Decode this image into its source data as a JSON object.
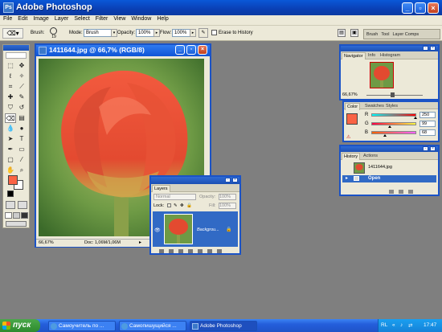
{
  "app": {
    "title": "Adobe Photoshop"
  },
  "menu": [
    "File",
    "Edit",
    "Image",
    "Layer",
    "Select",
    "Filter",
    "View",
    "Window",
    "Help"
  ],
  "options": {
    "brush_label": "Brush:",
    "brush_size": "19",
    "mode_label": "Mode:",
    "mode_value": "Brush",
    "opacity_label": "Opacity:",
    "opacity_value": "100%",
    "flow_label": "Flow:",
    "flow_value": "100%",
    "erase_history_label": "Erase to History",
    "palette_well_tabs": [
      "Brush",
      "Tool",
      "Layer Comps"
    ]
  },
  "document": {
    "title": "1411644.jpg @ 66,7% (RGB/8)",
    "zoom": "66,67%",
    "doc_info": "Doc: 1,06M/1,06M"
  },
  "navigator": {
    "tabs": [
      "Navigator",
      "Info",
      "Histogram"
    ],
    "zoom": "66,67%"
  },
  "color": {
    "tabs": [
      "Color",
      "Swatches",
      "Styles"
    ],
    "channels": [
      {
        "label": "R",
        "value": "250",
        "slider": 0.98
      },
      {
        "label": "G",
        "value": "99",
        "slider": 0.39
      },
      {
        "label": "B",
        "value": "68",
        "slider": 0.27
      }
    ],
    "foreground": "#fa6344"
  },
  "history": {
    "tabs": [
      "History",
      "Actions"
    ],
    "snapshot_name": "1411644.jpg",
    "states": [
      "Open"
    ]
  },
  "layers": {
    "tab": "Layers",
    "blend_mode": "Normal",
    "opacity_label": "Opacity:",
    "opacity_value": "100%",
    "lock_label": "Lock:",
    "fill_label": "Fill:",
    "fill_value": "100%",
    "layer_name": "Backgrou..."
  },
  "taskbar": {
    "start": "пуск",
    "buttons": [
      "Самоучитель по ...",
      "Самопишущийся ...",
      "Adobe Photoshop"
    ],
    "lang": "RL",
    "time": "17:47"
  }
}
